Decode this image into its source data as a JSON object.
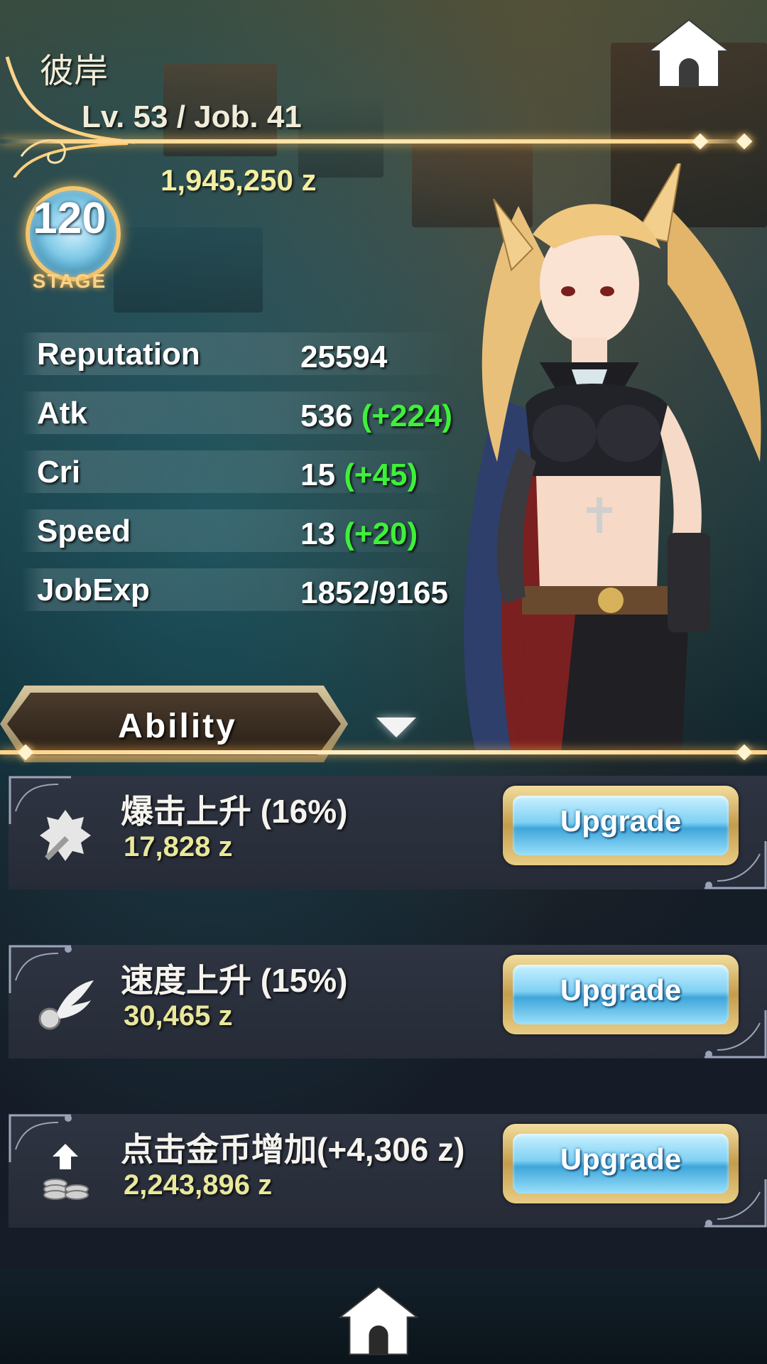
{
  "header": {
    "player_name": "彼岸",
    "level_text": "Lv. 53 / Job. 41",
    "zeny": "1,945,250 z",
    "stage_number": "120",
    "stage_label": "STAGE"
  },
  "stats": [
    {
      "label": "Reputation",
      "value": "25594",
      "bonus": ""
    },
    {
      "label": "Atk",
      "value": "536",
      "bonus": "(+224)"
    },
    {
      "label": "Cri",
      "value": "15",
      "bonus": "(+45)"
    },
    {
      "label": "Speed",
      "value": "13",
      "bonus": "(+20)"
    },
    {
      "label": "JobExp",
      "value": "1852/9165",
      "bonus": ""
    }
  ],
  "ability_section": {
    "title": "Ability"
  },
  "abilities": [
    {
      "name": "爆击上升 (16%)",
      "cost": "17,828 z",
      "button": "Upgrade",
      "icon": "critical-sword-icon"
    },
    {
      "name": "速度上升 (15%)",
      "cost": "30,465 z",
      "button": "Upgrade",
      "icon": "winged-orb-icon"
    },
    {
      "name": "点击金币增加(+4,306 z)",
      "cost": "2,243,896 z",
      "button": "Upgrade",
      "icon": "coin-stack-icon"
    }
  ],
  "colors": {
    "bonus_green": "#3ef03a",
    "cost_yellow": "#e9e79a",
    "gold_accent": "#ffd38a",
    "button_blue": "#7fd0f3"
  },
  "icons": {
    "home_top": "home-icon",
    "home_bottom": "home-icon",
    "collapse": "chevron-down-icon"
  }
}
